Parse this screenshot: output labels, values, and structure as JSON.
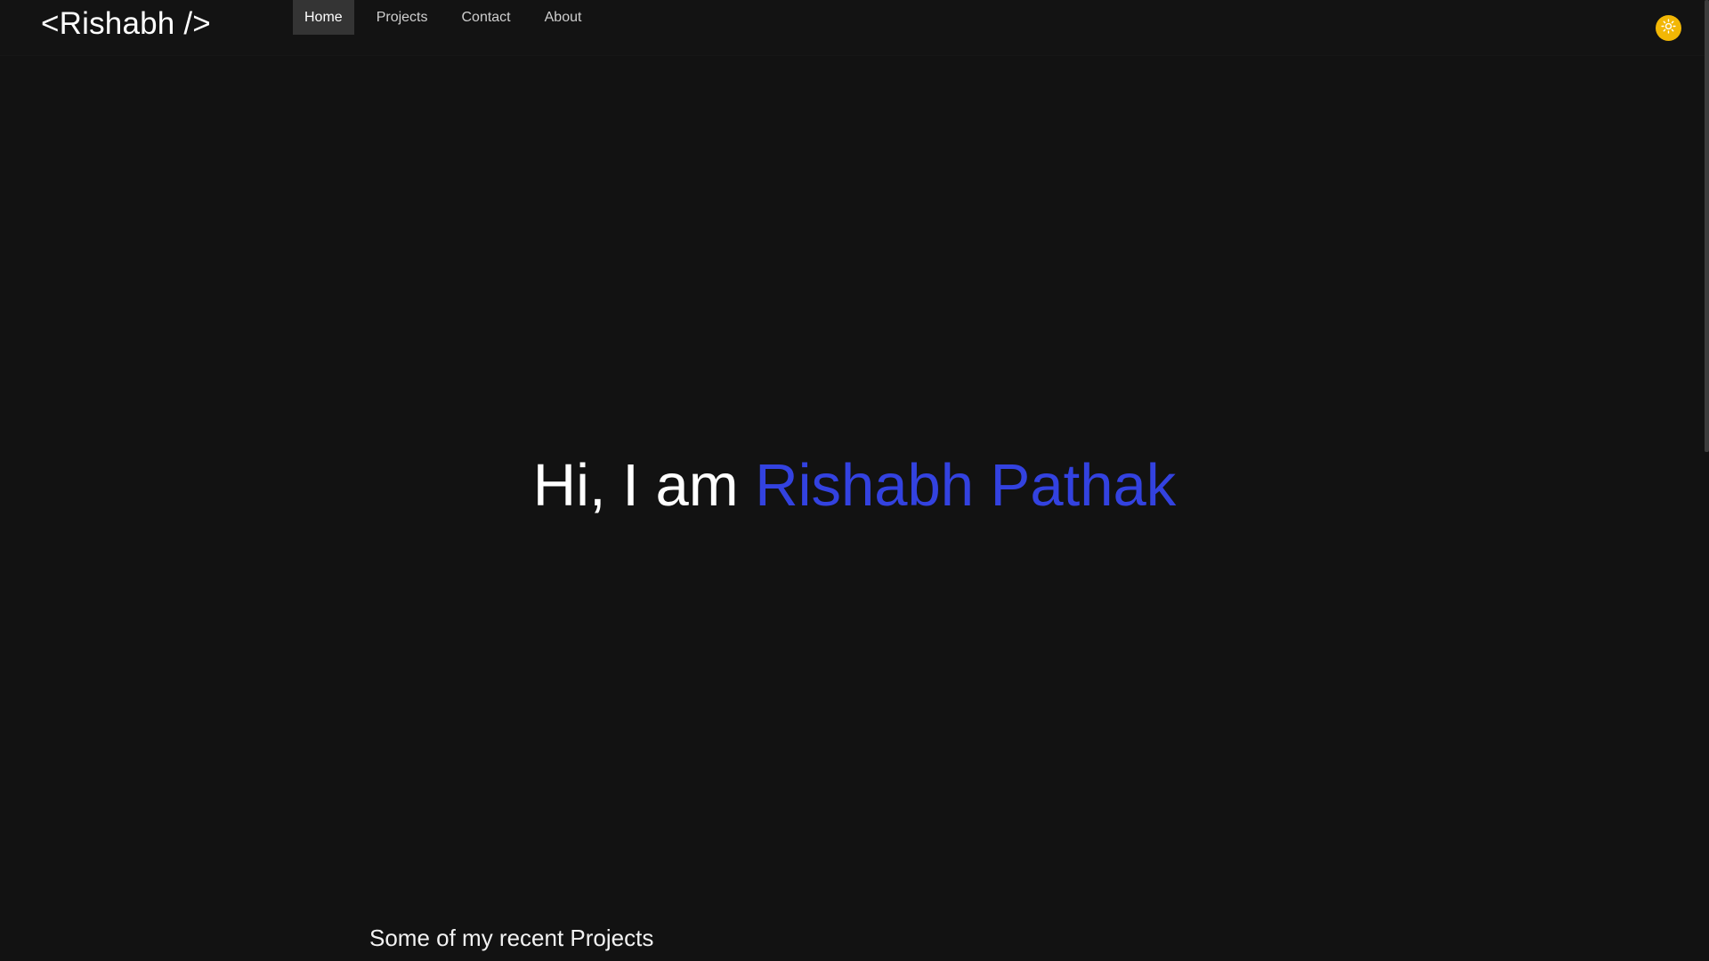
{
  "nav": {
    "logo": "<Rishabh />",
    "links": [
      {
        "label": "Home",
        "active": true
      },
      {
        "label": "Projects",
        "active": false
      },
      {
        "label": "Contact",
        "active": false
      },
      {
        "label": "About",
        "active": false
      }
    ],
    "theme_toggle_icon": "sun-icon",
    "theme_toggle_color": "#f2b705"
  },
  "hero": {
    "greeting": "Hi, I am",
    "name": "Rishabh Pathak",
    "name_color": "#3342e0"
  },
  "projects_section": {
    "title": "Some of my recent Projects"
  },
  "colors": {
    "background": "#121212",
    "nav_active_bg": "#343434"
  }
}
